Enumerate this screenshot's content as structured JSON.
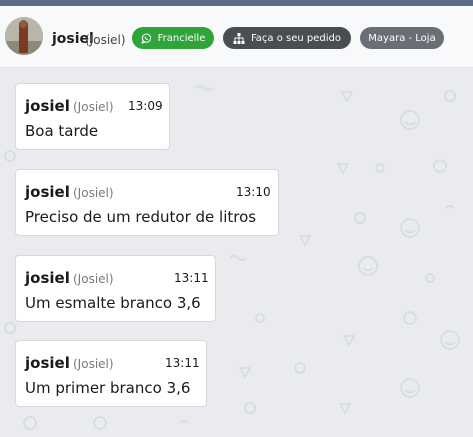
{
  "header": {
    "contact_name": "josiel",
    "contact_sub": "(Josiel)",
    "agent_label": "Francielle",
    "order_label": "Faça o seu pedido",
    "store_label": "Mayara - Loja"
  },
  "messages": [
    {
      "sender": "josiel",
      "sender_sub": "(Josiel)",
      "time": "13:09",
      "text": "Boa tarde"
    },
    {
      "sender": "josiel",
      "sender_sub": "(Josiel)",
      "time": "13:10",
      "text": "Preciso de um redutor de litros"
    },
    {
      "sender": "josiel",
      "sender_sub": "(Josiel)",
      "time": "13:11",
      "text": "Um esmalte branco 3,6"
    },
    {
      "sender": "josiel",
      "sender_sub": "(Josiel)",
      "time": "13:11",
      "text": "Um primer branco 3,6"
    }
  ],
  "icons": {
    "agent": "whatsapp-icon",
    "order": "sitemap-icon"
  },
  "colors": {
    "top_bar": "#5b6b86",
    "agent_pill": "#2ea43a",
    "order_pill": "#4a4d52",
    "store_pill": "#6b6f75",
    "chat_background": "#e9ebee"
  }
}
